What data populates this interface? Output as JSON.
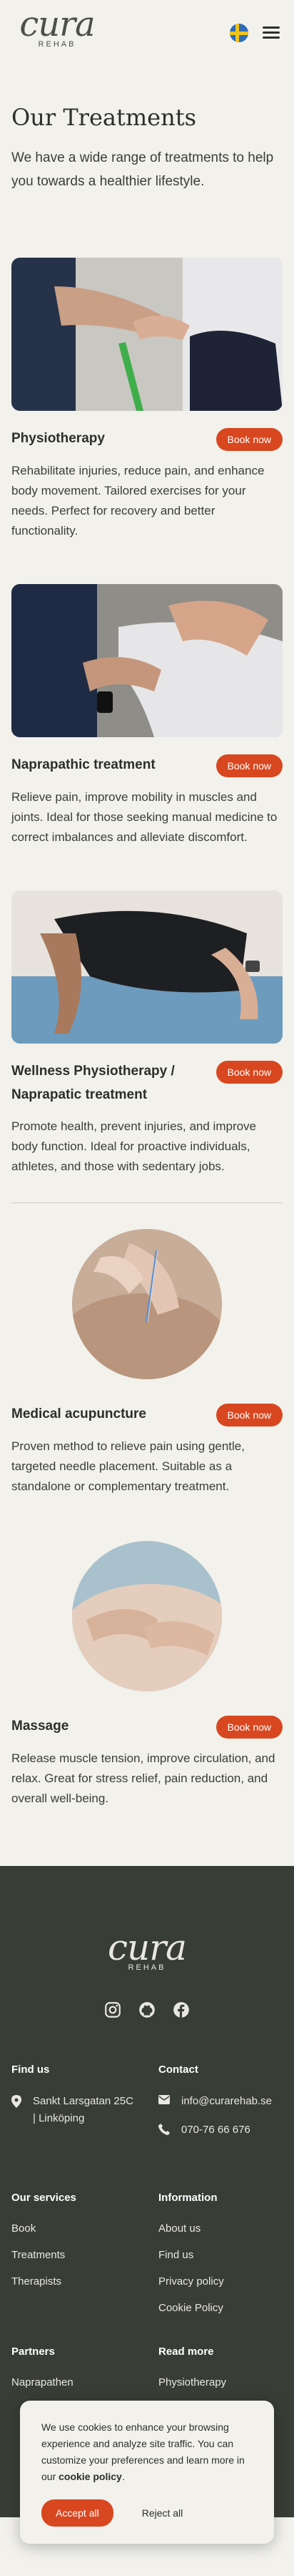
{
  "header": {
    "logo_word": "cura",
    "logo_sub": "REHAB",
    "flag_icon": "sweden-flag-icon",
    "menu_icon": "hamburger-menu-icon"
  },
  "intro": {
    "title": "Our Treatments",
    "lead": "We have a wide range of treatments to help you towards a healthier lifestyle."
  },
  "treatments": [
    {
      "name": "Physiotherapy",
      "book_label": "Book now",
      "description": "Rehabilitate injuries, reduce pain, and enhance body movement. Tailored exercises for your needs. Perfect for recovery and better functionality."
    },
    {
      "name": "Naprapathic treatment",
      "book_label": "Book now",
      "description": "Relieve pain, improve mobility in muscles and joints. Ideal for those seeking manual medicine to correct imbalances and alleviate discomfort."
    },
    {
      "name": "Wellness Physiotherapy / Naprapatic treatment",
      "book_label": "Book now",
      "description": "Promote health, prevent injuries, and improve body function. Ideal for proactive individuals, athletes, and those with sedentary jobs."
    },
    {
      "name": "Medical acupuncture",
      "book_label": "Book now",
      "description": "Proven method to relieve pain using gentle, targeted needle placement. Suitable as a standalone or complementary treatment."
    },
    {
      "name": "Massage",
      "book_label": "Book now",
      "description": "Release muscle tension, improve circulation, and relax. Great for stress relief, pain reduction, and overall well-being."
    }
  ],
  "footer": {
    "logo_word": "cura",
    "logo_sub": "REHAB",
    "socials": [
      "instagram-icon",
      "github-icon",
      "facebook-icon"
    ],
    "find_us": {
      "heading": "Find us",
      "address_line1": "Sankt Larsgatan 25C",
      "address_line2": "| Linköping"
    },
    "contact": {
      "heading": "Contact",
      "email": "info@curarehab.se",
      "phone": "070-76 66 676"
    },
    "services": {
      "heading": "Our services",
      "links": [
        "Book",
        "Treatments",
        "Therapists"
      ]
    },
    "information": {
      "heading": "Information",
      "links": [
        "About us",
        "Find us",
        "Privacy policy",
        "Cookie Policy"
      ]
    },
    "partners": {
      "heading": "Partners",
      "links": [
        "Naprapathen"
      ]
    },
    "read_more": {
      "heading": "Read more",
      "links": [
        "Physiotherapy"
      ]
    }
  },
  "cookie": {
    "text_before": "We use cookies to enhance your browsing experience and analyze site traffic. You can customize your preferences and learn more in our ",
    "policy_link": "cookie policy",
    "text_after": ".",
    "accept_label": "Accept all",
    "reject_label": "Reject all"
  },
  "colors": {
    "background": "#f2f1ec",
    "accent": "#d8471f",
    "footer_bg": "#383d35",
    "text": "#2b2f2a"
  }
}
